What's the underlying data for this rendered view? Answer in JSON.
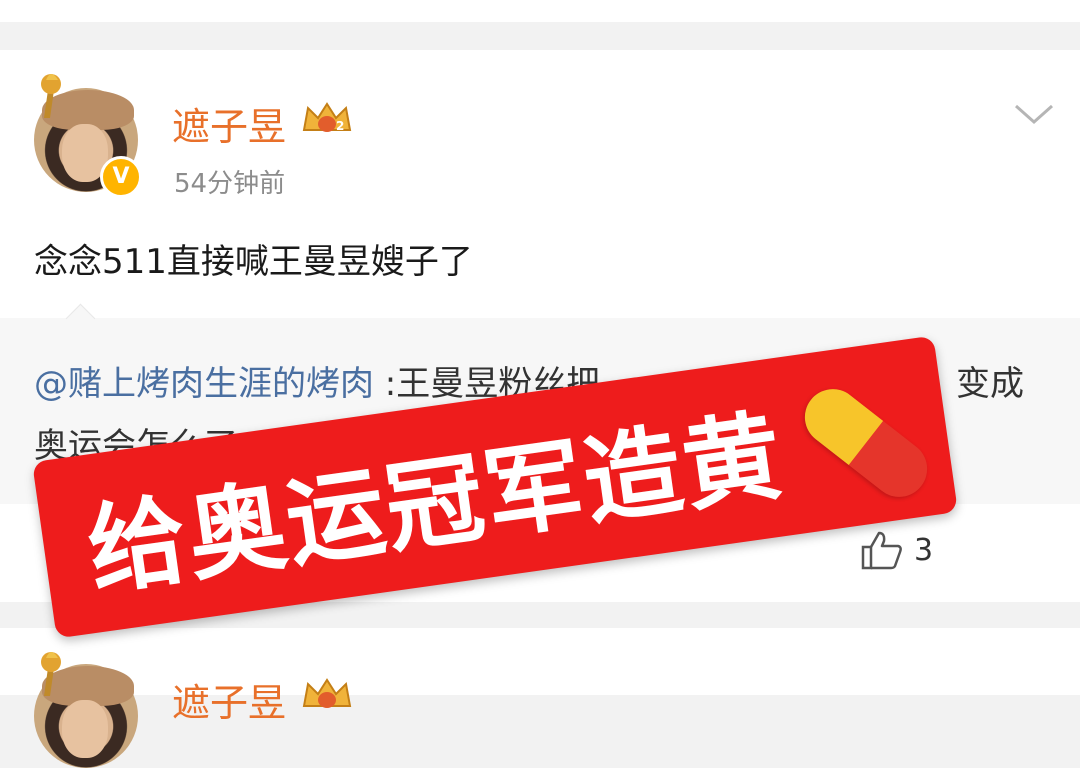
{
  "post": {
    "author": "遮子昱",
    "time": "54分钟前",
    "text": "念念511直接喊王曼昱嫂子了",
    "quote": {
      "mention": "@赌上烤肉生涯的烤肉",
      "line1_rest": " :王曼昱粉丝把",
      "line1_end": "变成",
      "line2": "奥运会怎么了"
    },
    "likes": "3"
  },
  "next_post": {
    "author": "遮子昱"
  },
  "overlay": {
    "banner_text": "给奥运冠军造黄"
  },
  "icons": {
    "verified": "verified-v-icon",
    "crown": "crown-badge-icon",
    "menu": "chevron-down-icon",
    "like": "thumbs-up-icon",
    "pill": "pill-emoji-icon"
  },
  "colors": {
    "username": "#e8702a",
    "mention": "#4a6fa1",
    "banner": "#ee1c1c",
    "verified": "#ffb400"
  }
}
